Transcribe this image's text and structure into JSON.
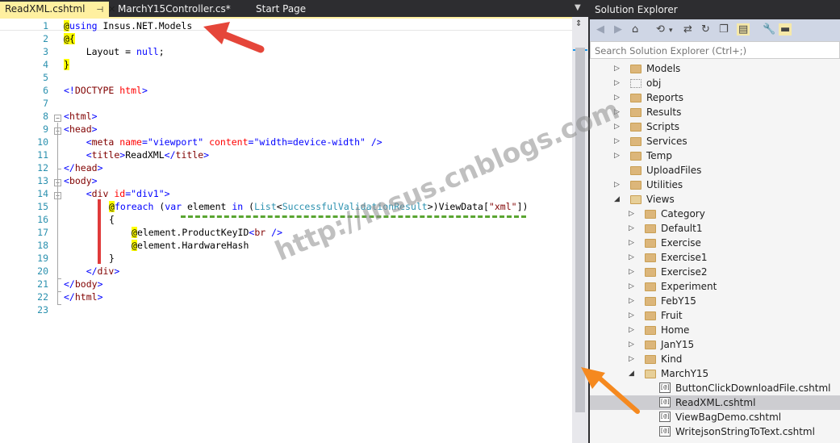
{
  "tabs": [
    {
      "label": "ReadXML.cshtml",
      "active": true,
      "pin": "pin-icon",
      "close": "close-icon"
    },
    {
      "label": "MarchY15Controller.cs*",
      "active": false
    },
    {
      "label": "Start Page",
      "active": false
    }
  ],
  "editor": {
    "line_numbers": [
      "1",
      "2",
      "3",
      "4",
      "5",
      "6",
      "7",
      "8",
      "9",
      "10",
      "11",
      "12",
      "13",
      "14",
      "15",
      "16",
      "17",
      "18",
      "19",
      "20",
      "21",
      "22",
      "23"
    ]
  },
  "code_parts": {
    "l1_at": "@",
    "l1_kw": "using",
    "l1_rest": " Insus.NET.Models",
    "l2_at": "@{",
    "l3_a": "    Layout = ",
    "l3_kw": "null",
    "l3_b": ";",
    "l4_brace": "}",
    "l6_a": "<!",
    "l6_b": "DOCTYPE",
    "l6_c": " html",
    "l6_d": ">",
    "l8_a": "<",
    "l8_b": "html",
    "l8_c": ">",
    "l9_a": "<",
    "l9_b": "head",
    "l9_c": ">",
    "l10_a": "    <",
    "l10_b": "meta",
    "l10_c": " name",
    "l10_d": "=",
    "l10_e": "\"viewport\"",
    "l10_f": " content",
    "l10_g": "=",
    "l10_h": "\"width=device-width\"",
    "l10_i": " />",
    "l11_a": "    <",
    "l11_b": "title",
    "l11_c": ">",
    "l11_d": "ReadXML",
    "l11_e": "</",
    "l11_f": "title",
    "l11_g": ">",
    "l12_a": "</",
    "l12_b": "head",
    "l12_c": ">",
    "l13_a": "<",
    "l13_b": "body",
    "l13_c": ">",
    "l14_a": "    <",
    "l14_b": "div",
    "l14_c": " id",
    "l14_d": "=",
    "l14_e": "\"div1\"",
    "l14_f": ">",
    "l15_at": "@",
    "l15_kw": "foreach",
    "l15_a": " (",
    "l15_var": "var",
    "l15_b": " element ",
    "l15_in": "in",
    "l15_c": " (",
    "l15_list": "List",
    "l15_d": "<",
    "l15_svr": "SuccessfulValidationResult",
    "l15_e": ">)ViewData[",
    "l15_q1": "\"",
    "l15_xml": "xml",
    "l15_q2": "\"",
    "l15_f": "])",
    "l16": "{",
    "l17_at": "@",
    "l17_a": "element.ProductKeyID",
    "l17_b": "<",
    "l17_c": "br",
    "l17_d": " />",
    "l18_at": "@",
    "l18_a": "element.HardwareHash",
    "l19": "}",
    "l20_a": "    </",
    "l20_b": "div",
    "l20_c": ">",
    "l21_a": "</",
    "l21_b": "body",
    "l21_c": ">",
    "l22_a": "</",
    "l22_b": "html",
    "l22_c": ">"
  },
  "solution_explorer": {
    "title": "Solution Explorer",
    "search_placeholder": "Search Solution Explorer (Ctrl+;)",
    "toolbar_icons": [
      "back-icon",
      "forward-icon",
      "home-icon",
      "history-icon",
      "dropdown-icon",
      "sync-icon",
      "refresh-icon",
      "collapse-all-icon",
      "show-all-files-icon",
      "properties-icon",
      "preview-icon"
    ],
    "items": [
      {
        "label": "Models",
        "level": 0,
        "expander": "collapsed",
        "icon": "folder"
      },
      {
        "label": "obj",
        "level": 0,
        "expander": "collapsed",
        "icon": "folder-dotted"
      },
      {
        "label": "Reports",
        "level": 0,
        "expander": "collapsed",
        "icon": "folder"
      },
      {
        "label": "Results",
        "level": 0,
        "expander": "collapsed",
        "icon": "folder"
      },
      {
        "label": "Scripts",
        "level": 0,
        "expander": "collapsed",
        "icon": "folder"
      },
      {
        "label": "Services",
        "level": 0,
        "expander": "collapsed",
        "icon": "folder"
      },
      {
        "label": "Temp",
        "level": 0,
        "expander": "collapsed",
        "icon": "folder"
      },
      {
        "label": "UploadFiles",
        "level": 0,
        "expander": "none",
        "icon": "folder"
      },
      {
        "label": "Utilities",
        "level": 0,
        "expander": "collapsed",
        "icon": "folder"
      },
      {
        "label": "Views",
        "level": 0,
        "expander": "expanded",
        "icon": "folder-open"
      },
      {
        "label": "Category",
        "level": 1,
        "expander": "collapsed",
        "icon": "folder"
      },
      {
        "label": "Default1",
        "level": 1,
        "expander": "collapsed",
        "icon": "folder"
      },
      {
        "label": "Exercise",
        "level": 1,
        "expander": "collapsed",
        "icon": "folder"
      },
      {
        "label": "Exercise1",
        "level": 1,
        "expander": "collapsed",
        "icon": "folder"
      },
      {
        "label": "Exercise2",
        "level": 1,
        "expander": "collapsed",
        "icon": "folder"
      },
      {
        "label": "Experiment",
        "level": 1,
        "expander": "collapsed",
        "icon": "folder"
      },
      {
        "label": "FebY15",
        "level": 1,
        "expander": "collapsed",
        "icon": "folder"
      },
      {
        "label": "Fruit",
        "level": 1,
        "expander": "collapsed",
        "icon": "folder"
      },
      {
        "label": "Home",
        "level": 1,
        "expander": "collapsed",
        "icon": "folder"
      },
      {
        "label": "JanY15",
        "level": 1,
        "expander": "collapsed",
        "icon": "folder"
      },
      {
        "label": "Kind",
        "level": 1,
        "expander": "collapsed",
        "icon": "folder"
      },
      {
        "label": "MarchY15",
        "level": 1,
        "expander": "expanded",
        "icon": "folder-open"
      },
      {
        "label": "ButtonClickDownloadFile.cshtml",
        "level": 2,
        "expander": "none",
        "icon": "razor-file"
      },
      {
        "label": "ReadXML.cshtml",
        "level": 2,
        "expander": "none",
        "icon": "razor-file",
        "selected": true
      },
      {
        "label": "ViewBagDemo.cshtml",
        "level": 2,
        "expander": "none",
        "icon": "razor-file"
      },
      {
        "label": "WritejsonStringToText.cshtml",
        "level": 2,
        "expander": "none",
        "icon": "razor-file"
      }
    ]
  },
  "watermark": "http://insus.cnblogs.com",
  "colors": {
    "active_tab": "#fff0a0",
    "razor_highlight": "#ffff00",
    "annotation_red": "#e5463a",
    "annotation_orange": "#f5891f",
    "dash_green": "#5aa532"
  }
}
